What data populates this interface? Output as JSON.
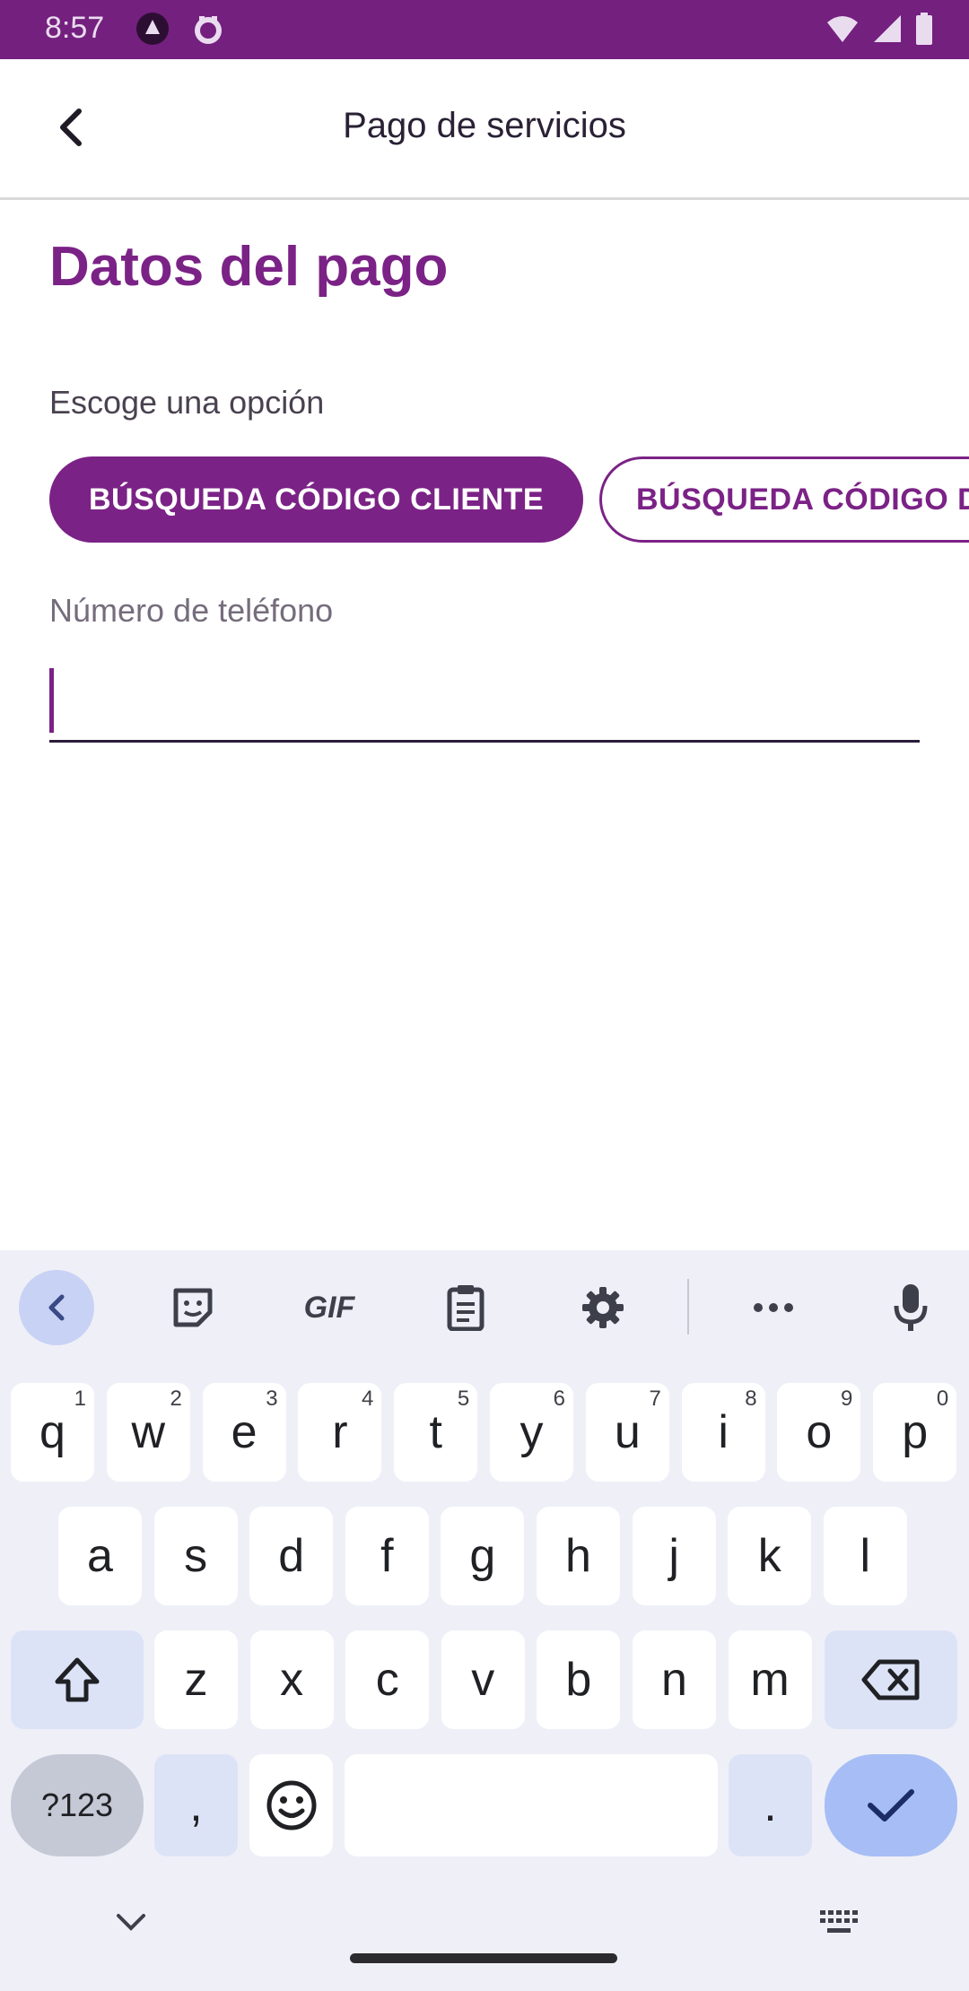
{
  "status_bar": {
    "time": "8:57",
    "icons_left": [
      "app-notification-icon",
      "game-notification-icon"
    ],
    "icons_right": [
      "wifi-icon",
      "signal-icon",
      "battery-icon"
    ]
  },
  "app_bar": {
    "title": "Pago de servicios",
    "back_icon": "chevron-left-icon"
  },
  "content": {
    "section_title": "Datos del pago",
    "option_label": "Escoge una opción",
    "options": [
      {
        "label": "BÚSQUEDA CÓDIGO CLIENTE",
        "selected": true
      },
      {
        "label": "BÚSQUEDA CÓDIGO DE",
        "selected": false
      }
    ],
    "phone_field": {
      "label": "Número de teléfono",
      "value": ""
    }
  },
  "keyboard": {
    "toolbar": [
      "back-icon",
      "sticker-icon",
      "gif-icon",
      "clipboard-icon",
      "settings-icon",
      "more-icon",
      "mic-icon"
    ],
    "gif_label": "GIF",
    "row1": [
      {
        "k": "q",
        "h": "1"
      },
      {
        "k": "w",
        "h": "2"
      },
      {
        "k": "e",
        "h": "3"
      },
      {
        "k": "r",
        "h": "4"
      },
      {
        "k": "t",
        "h": "5"
      },
      {
        "k": "y",
        "h": "6"
      },
      {
        "k": "u",
        "h": "7"
      },
      {
        "k": "i",
        "h": "8"
      },
      {
        "k": "o",
        "h": "9"
      },
      {
        "k": "p",
        "h": "0"
      }
    ],
    "row2": [
      "a",
      "s",
      "d",
      "f",
      "g",
      "h",
      "j",
      "k",
      "l"
    ],
    "row3": [
      "z",
      "x",
      "c",
      "v",
      "b",
      "n",
      "m"
    ],
    "symbols_label": "?123",
    "comma": ",",
    "period": ".",
    "colors": {
      "accent": "#7b2286",
      "status_bar": "#74207f",
      "action_key": "#a7bdf5"
    }
  }
}
